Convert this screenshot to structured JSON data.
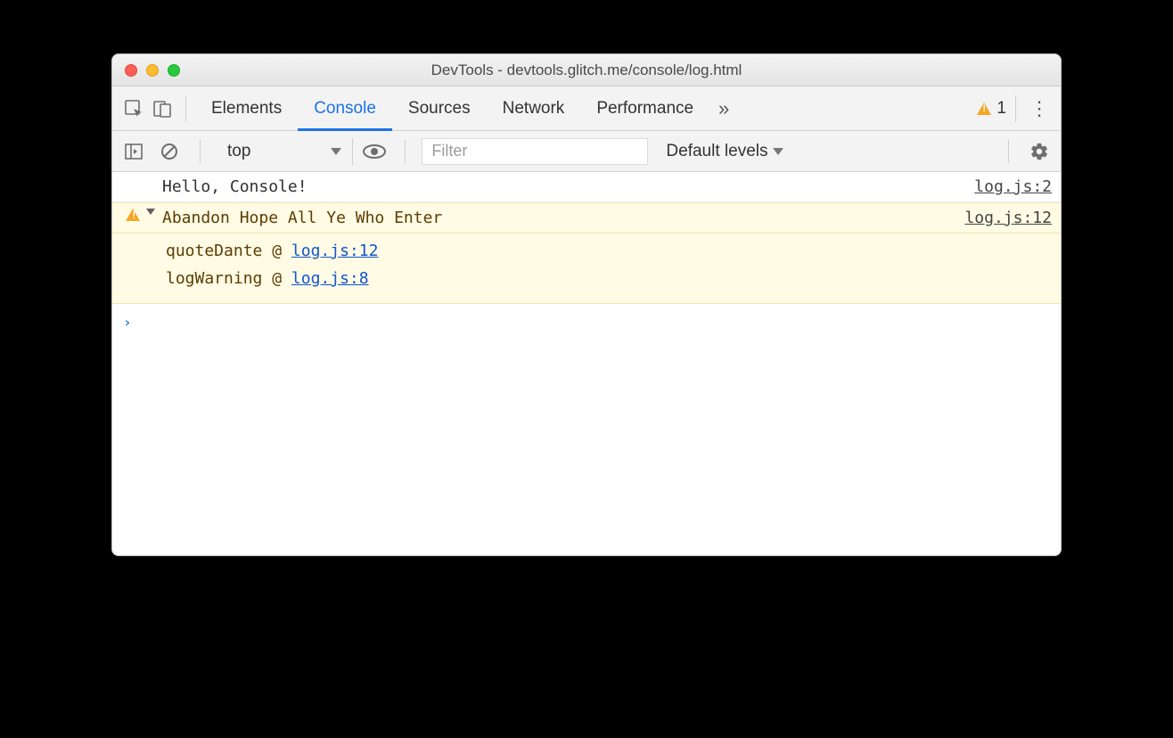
{
  "window": {
    "title": "DevTools - devtools.glitch.me/console/log.html"
  },
  "tabs": {
    "elements": "Elements",
    "console": "Console",
    "sources": "Sources",
    "network": "Network",
    "performance": "Performance"
  },
  "warning_count": "1",
  "toolbar": {
    "context": "top",
    "filter_placeholder": "Filter",
    "levels": "Default levels"
  },
  "logs": {
    "info": {
      "message": "Hello, Console!",
      "source": "log.js:2"
    },
    "warning": {
      "message": "Abandon Hope All Ye Who Enter",
      "source": "log.js:12",
      "stack": [
        {
          "fn": "quoteDante",
          "at": "log.js:12"
        },
        {
          "fn": "logWarning",
          "at": "log.js:8"
        }
      ]
    }
  }
}
